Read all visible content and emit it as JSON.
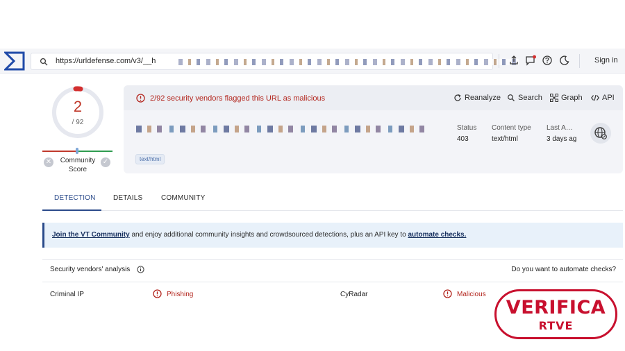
{
  "topbar": {
    "url": "https://urldefense.com/v3/__h",
    "signin": "Sign in"
  },
  "score": {
    "detections": "2",
    "total": "/ 92",
    "community_label": "Community",
    "community_label2": "Score"
  },
  "header": {
    "flag_text": "2/92 security vendors flagged this URL as malicious",
    "actions": [
      "Reanalyze",
      "Search",
      "Graph",
      "API"
    ],
    "status_label": "Status",
    "status_value": "403",
    "content_type_label": "Content type",
    "content_type_value": "text/html",
    "last_label": "Last A…",
    "last_value": "3 days ag",
    "tag": "text/html"
  },
  "tabs": [
    "DETECTION",
    "DETAILS",
    "COMMUNITY"
  ],
  "banner": {
    "link1": "Join the VT Community",
    "middle": " and enjoy additional community insights and crowdsourced detections, plus an API key to ",
    "link2": "automate checks."
  },
  "analysis": {
    "title": "Security vendors' analysis",
    "right": "Do you want to automate checks?",
    "rows": [
      {
        "vendor1": "Criminal IP",
        "result1": "Phishing",
        "vendor2": "CyRadar",
        "result2": "Malicious"
      }
    ]
  },
  "watermark": {
    "line1": "VERIFICA",
    "line2": "RTVE"
  },
  "colors": {
    "malicious": "#b3261e",
    "accent": "#2a4a8a",
    "watermark": "#c8102e"
  }
}
